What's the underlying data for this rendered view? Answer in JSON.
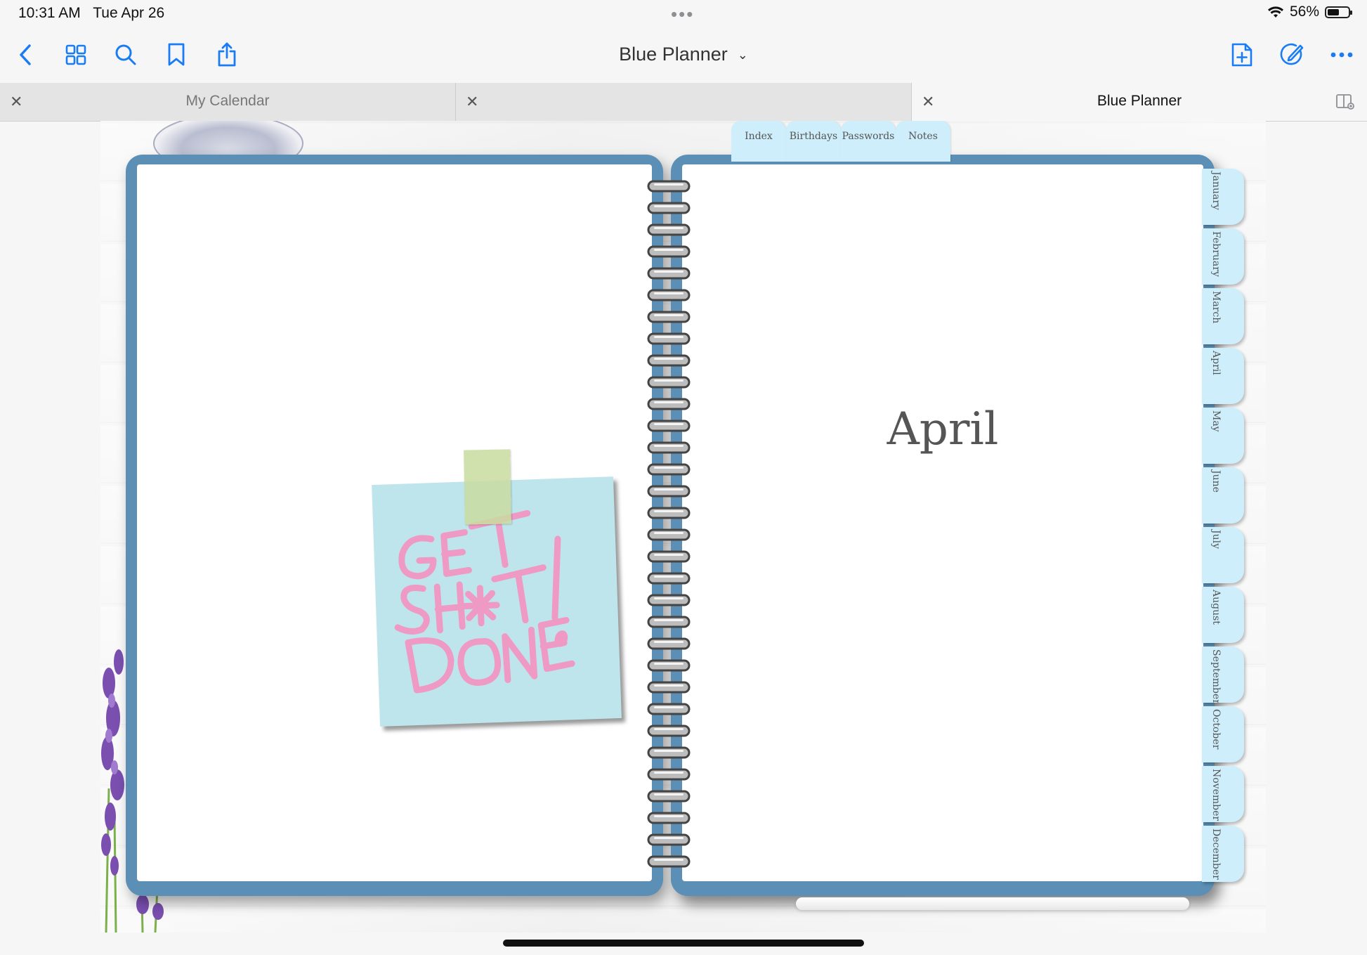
{
  "status_bar": {
    "time": "10:31 AM",
    "date": "Tue Apr 26",
    "multitask_indicator": "•••",
    "battery_percent": "56%",
    "battery_level": 0.56,
    "icons": [
      "wifi-icon",
      "battery-icon"
    ]
  },
  "toolbar": {
    "left_icons": [
      "back-chevron-icon",
      "thumbnails-grid-icon",
      "search-icon",
      "bookmark-icon",
      "share-icon"
    ],
    "title": "Blue Planner",
    "title_icon": "chevron-down-icon",
    "right_icons": [
      "add-page-icon",
      "pen-edit-icon",
      "more-icon"
    ],
    "accent_color": "#1a7cf5"
  },
  "tabs": [
    {
      "label": "My Calendar",
      "active": false
    },
    {
      "label": "",
      "active": false
    },
    {
      "label": "Blue Planner",
      "active": true
    }
  ],
  "planner": {
    "index_tabs": [
      "Index",
      "Birthdays",
      "Passwords",
      "Notes"
    ],
    "month_tabs": [
      "January",
      "February",
      "March",
      "April",
      "May",
      "June",
      "July",
      "August",
      "September",
      "October",
      "November",
      "December"
    ],
    "month_heading": "April",
    "sticky_note": {
      "lines": [
        "GET",
        "SH*T",
        "DONE!"
      ],
      "ink_color": "#ee9ac4",
      "note_color": "#bfe5ec"
    },
    "cover_color": "#5b8fb5",
    "tab_color": "#cdeefa"
  }
}
